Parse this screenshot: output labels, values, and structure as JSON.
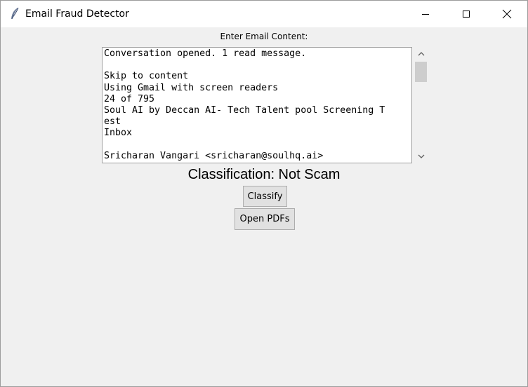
{
  "window": {
    "title": "Email Fraud Detector",
    "icon": "feather-icon"
  },
  "controls": {
    "minimize": "minimize-icon",
    "maximize": "maximize-icon",
    "close": "close-icon"
  },
  "form": {
    "label": "Enter Email Content:",
    "lines": [
      "Conversation opened. 1 read message.",
      "",
      "Skip to content",
      "Using Gmail with screen readers",
      "24 of 795",
      "Soul AI by Deccan AI- Tech Talent pool Screening T",
      "est",
      "Inbox",
      "",
      "Sricharan Vangari <sricharan@soulhq.ai>"
    ]
  },
  "result": {
    "classification": "Classification: Not Scam"
  },
  "buttons": {
    "classify": "Classify",
    "open_pdfs": "Open PDFs"
  }
}
